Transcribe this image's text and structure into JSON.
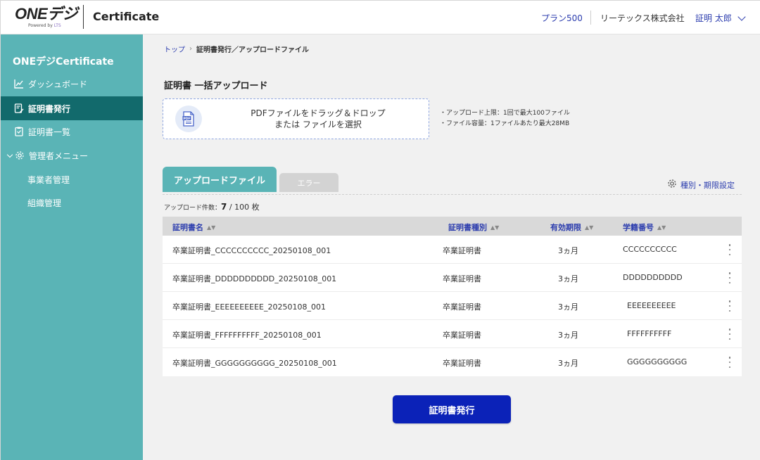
{
  "header": {
    "logo_text": "ONEデジ",
    "logo_powered": "Powered by",
    "logo_brand": "LTS",
    "app_title": "Certificate",
    "plan": "プラン500",
    "company": "リーテックス株式会社",
    "user": "証明 太郎"
  },
  "sidebar": {
    "title": "ONEデジCertificate",
    "items": [
      {
        "label": "ダッシュボード",
        "icon": "chart-icon"
      },
      {
        "label": "証明書発行",
        "icon": "document-edit-icon",
        "active": true
      },
      {
        "label": "証明書一覧",
        "icon": "document-list-icon"
      },
      {
        "label": "管理者メニュー",
        "icon": "gear-icon"
      },
      {
        "label": "事業者管理"
      },
      {
        "label": "組織管理"
      }
    ]
  },
  "breadcrumb": {
    "top": "トップ",
    "current": "証明書発行／アップロードファイル"
  },
  "page_title": "証明書 一括アップロード",
  "dropzone": {
    "line1": "PDFファイルをドラッグ＆ドロップ",
    "line2": "または ファイルを選択",
    "icon_label": "PDF"
  },
  "notes": [
    "・アップロード上限：1回で最大100ファイル",
    "・ファイル容量：1ファイルあたり最大28MB"
  ],
  "tabs": {
    "active": "アップロードファイル",
    "inactive": "エラー"
  },
  "settings_link": "種別・期限設定",
  "upload_count": {
    "label": "アップロード件数：",
    "count": "7",
    "total": " / 100 枚"
  },
  "table": {
    "headers": [
      "証明書名",
      "証明書種別",
      "有効期限",
      "学籍番号"
    ],
    "sort_glyph": "▲▼",
    "rows": [
      [
        "卒業証明書_CCCCCCCCCC_20250108_001",
        "卒業証明書",
        "3ヵ月",
        "CCCCCCCCCC"
      ],
      [
        "卒業証明書_DDDDDDDDDD_20250108_001",
        "卒業証明書",
        "3ヵ月",
        "DDDDDDDDDD"
      ],
      [
        "卒業証明書_EEEEEEEEEE_20250108_001",
        "卒業証明書",
        "3ヵ月",
        "EEEEEEEEEE"
      ],
      [
        "卒業証明書_FFFFFFFFFF_20250108_001",
        "卒業証明書",
        "3ヵ月",
        "FFFFFFFFFF"
      ],
      [
        "卒業証明書_GGGGGGGGGG_20250108_001",
        "卒業証明書",
        "3ヵ月",
        "GGGGGGGGGG"
      ]
    ]
  },
  "issue_button": "証明書発行",
  "colors": {
    "sidebar": "#5ab4b6",
    "sidebar_active": "#126a6c",
    "accent_blue": "#2c3dae",
    "primary_button": "#0b22b8"
  }
}
